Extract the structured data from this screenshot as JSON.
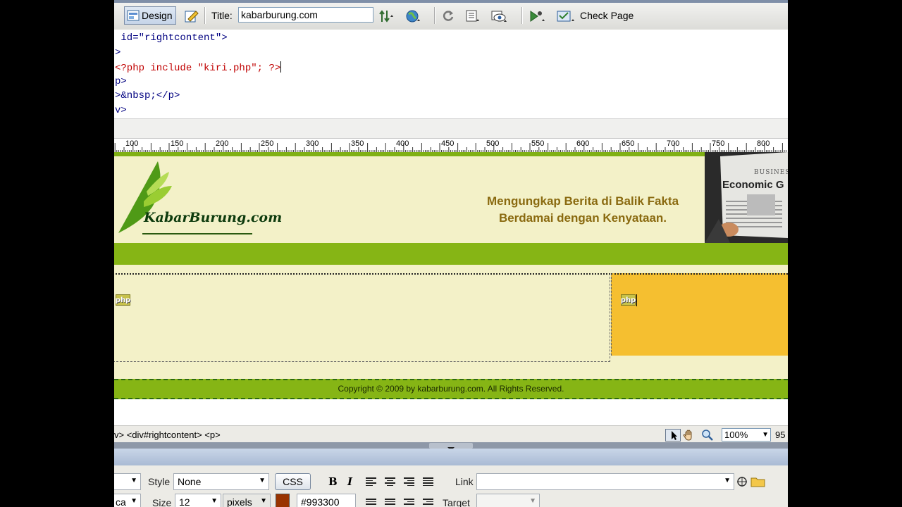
{
  "toolbar": {
    "design_label": "Design",
    "title_label": "Title:",
    "title_value": "kabarburung.com",
    "check_page_label": "Check Page"
  },
  "code": {
    "lines": [
      {
        "text": " id=\"rightcontent\">"
      },
      {
        "text": ">"
      },
      {
        "text": "<?php include \"kiri.php\"; ?>"
      },
      {
        "text": "p>"
      },
      {
        "text": ">&nbsp;</p>"
      },
      {
        "text": "v>"
      }
    ]
  },
  "ruler": {
    "labels": [
      "100",
      "150",
      "200",
      "250",
      "300",
      "350",
      "400",
      "450",
      "500",
      "550",
      "600",
      "650",
      "700",
      "750",
      "800"
    ]
  },
  "site": {
    "logo_text": "KabarBurung.com",
    "tagline_1": "Mengungkap Berita di Balik Fakta",
    "tagline_2": "Berdamai dengan Kenyataan.",
    "newspaper_top": "BUSINESS",
    "newspaper_headline": "Economic G",
    "php_icon_label": "php",
    "footer_text": "Copyright © 2009 by kabarburung.com. All Rights Reserved.",
    "colors": {
      "header_bg": "#f3f1c8",
      "green": "#86b515",
      "right_panel": "#f5bf30"
    }
  },
  "statusbar": {
    "tag_selector": "v> <div#rightcontent> <p>",
    "zoom": "100%",
    "dims": "95"
  },
  "properties": {
    "style_label": "Style",
    "style_value": "None",
    "css_button": "CSS",
    "bold": "B",
    "italic": "I",
    "link_label": "Link",
    "link_value": "",
    "font_partial": "ca",
    "size_label": "Size",
    "size_value": "12",
    "unit_value": "pixels",
    "color_value": "#993300",
    "target_label": "Target"
  }
}
